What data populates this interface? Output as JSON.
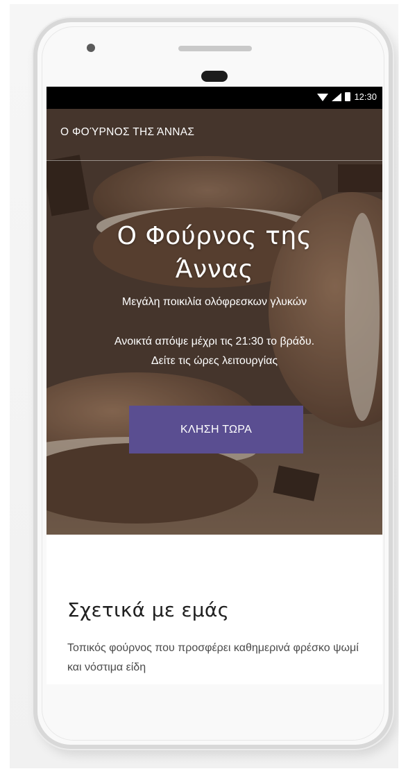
{
  "status_bar": {
    "time": "12:30",
    "icons": [
      "wifi-icon",
      "signal-icon",
      "battery-icon"
    ]
  },
  "header": {
    "site_name": "Ο ΦΟΎΡΝΟΣ ΤΗΣ ΆΝΝΑΣ"
  },
  "hero": {
    "title_line1": "Ο Φούρνος της",
    "title_line2": "Άννας",
    "subtitle": "Μεγάλη ποικιλία ολόφρεσκων γλυκών",
    "hours_text": "Ανοικτά απόψε μέχρι τις 21:30 το βράδυ. Δείτε τις ώρες λειτουργίας",
    "call_button_label": "ΚΛΗΣΗ ΤΩΡΑ"
  },
  "about": {
    "title": "Σχετικά με εμάς",
    "text": "Τοπικός φούρνος που προσφέρει καθημερινά φρέσκο ψωμί και νόστιμα είδη"
  },
  "colors": {
    "accent": "#5a4e91",
    "status_bar": "#000000",
    "hero_overlay": "#1c120c"
  }
}
